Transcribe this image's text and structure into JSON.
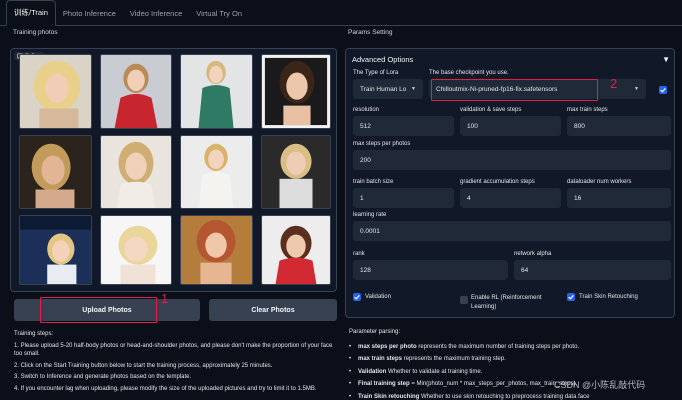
{
  "tabs": [
    {
      "label": "训练/Train"
    },
    {
      "label": "Photo Inference"
    },
    {
      "label": "Video Inference"
    },
    {
      "label": "Virtual Try On"
    }
  ],
  "left": {
    "title": "Training photos",
    "gallery_label": "Gallery",
    "upload_label": "Upload Photos",
    "clear_label": "Clear Photos",
    "annotation_1": "1",
    "steps_title": "Training steps:",
    "steps": [
      "1. Please upload 5-20 half-body photos or head-and-shoulder photos, and please don't make the proportion of your face too small.",
      "2. Click on the Start Training button below to start the training process, approximately 25 minutes.",
      "3. Switch to Inference and generate photos based on the template.",
      "4. If you encounter lag when uploading, please modify the size of the uploaded pictures and try to limit it to 1.5MB."
    ]
  },
  "right": {
    "title": "Params Setting",
    "advanced_title": "Advanced Options",
    "annotation_2": "2",
    "lora_type_label": "The Type of Lora",
    "lora_type_value": "Train Human Lo",
    "checkpoint_label": "The base checkpoint you use.",
    "checkpoint_value": "Chilloutmix-Ni-pruned-fp16-fix.safetensors",
    "fields": {
      "resolution": {
        "label": "resolution",
        "value": "512"
      },
      "validation": {
        "label": "validation & save steps",
        "value": "100"
      },
      "max_train_steps": {
        "label": "max train steps",
        "value": "800"
      },
      "max_steps_per_photos": {
        "label": "max steps per photos",
        "value": "200"
      },
      "train_batch_size": {
        "label": "train batch size",
        "value": "1"
      },
      "grad_accum": {
        "label": "gradient accumulation steps",
        "value": "4"
      },
      "dataloader": {
        "label": "dataloader num workers",
        "value": "16"
      },
      "learning_rate": {
        "label": "learning rate",
        "value": "0.0001"
      },
      "rank": {
        "label": "rank",
        "value": "128"
      },
      "network_alpha": {
        "label": "network alpha",
        "value": "64"
      }
    },
    "checkboxes": {
      "validation": {
        "label": "Validation",
        "checked": true
      },
      "rl": {
        "label": "Enable RL (Reinforcement Learning)",
        "checked": false
      },
      "skin": {
        "label": "Train Skin Retouching",
        "checked": true
      }
    }
  },
  "params_parsing": {
    "title": "Parameter parsing:",
    "items": [
      {
        "term": "max steps per photo",
        "desc": " represents the maximum number of training steps per photo."
      },
      {
        "term": "max train steps",
        "desc": " represents the maximum training step."
      },
      {
        "term": "Validation",
        "desc": " Whether to validate at training time."
      },
      {
        "term": "Final training step",
        "desc": " = Min(photo_num * max_steps_per_photos, max_train_steps)."
      },
      {
        "term": "Train Skin retouching",
        "desc": " Whether to use skin retouching to preprocess training data face"
      }
    ]
  },
  "watermark": "CSDN @小陈乱敲代码",
  "colors": {
    "background": "#0b0f19",
    "panel": "#111827",
    "input": "#1f2937",
    "accent": "#2563eb",
    "annotation": "#e11d48"
  }
}
